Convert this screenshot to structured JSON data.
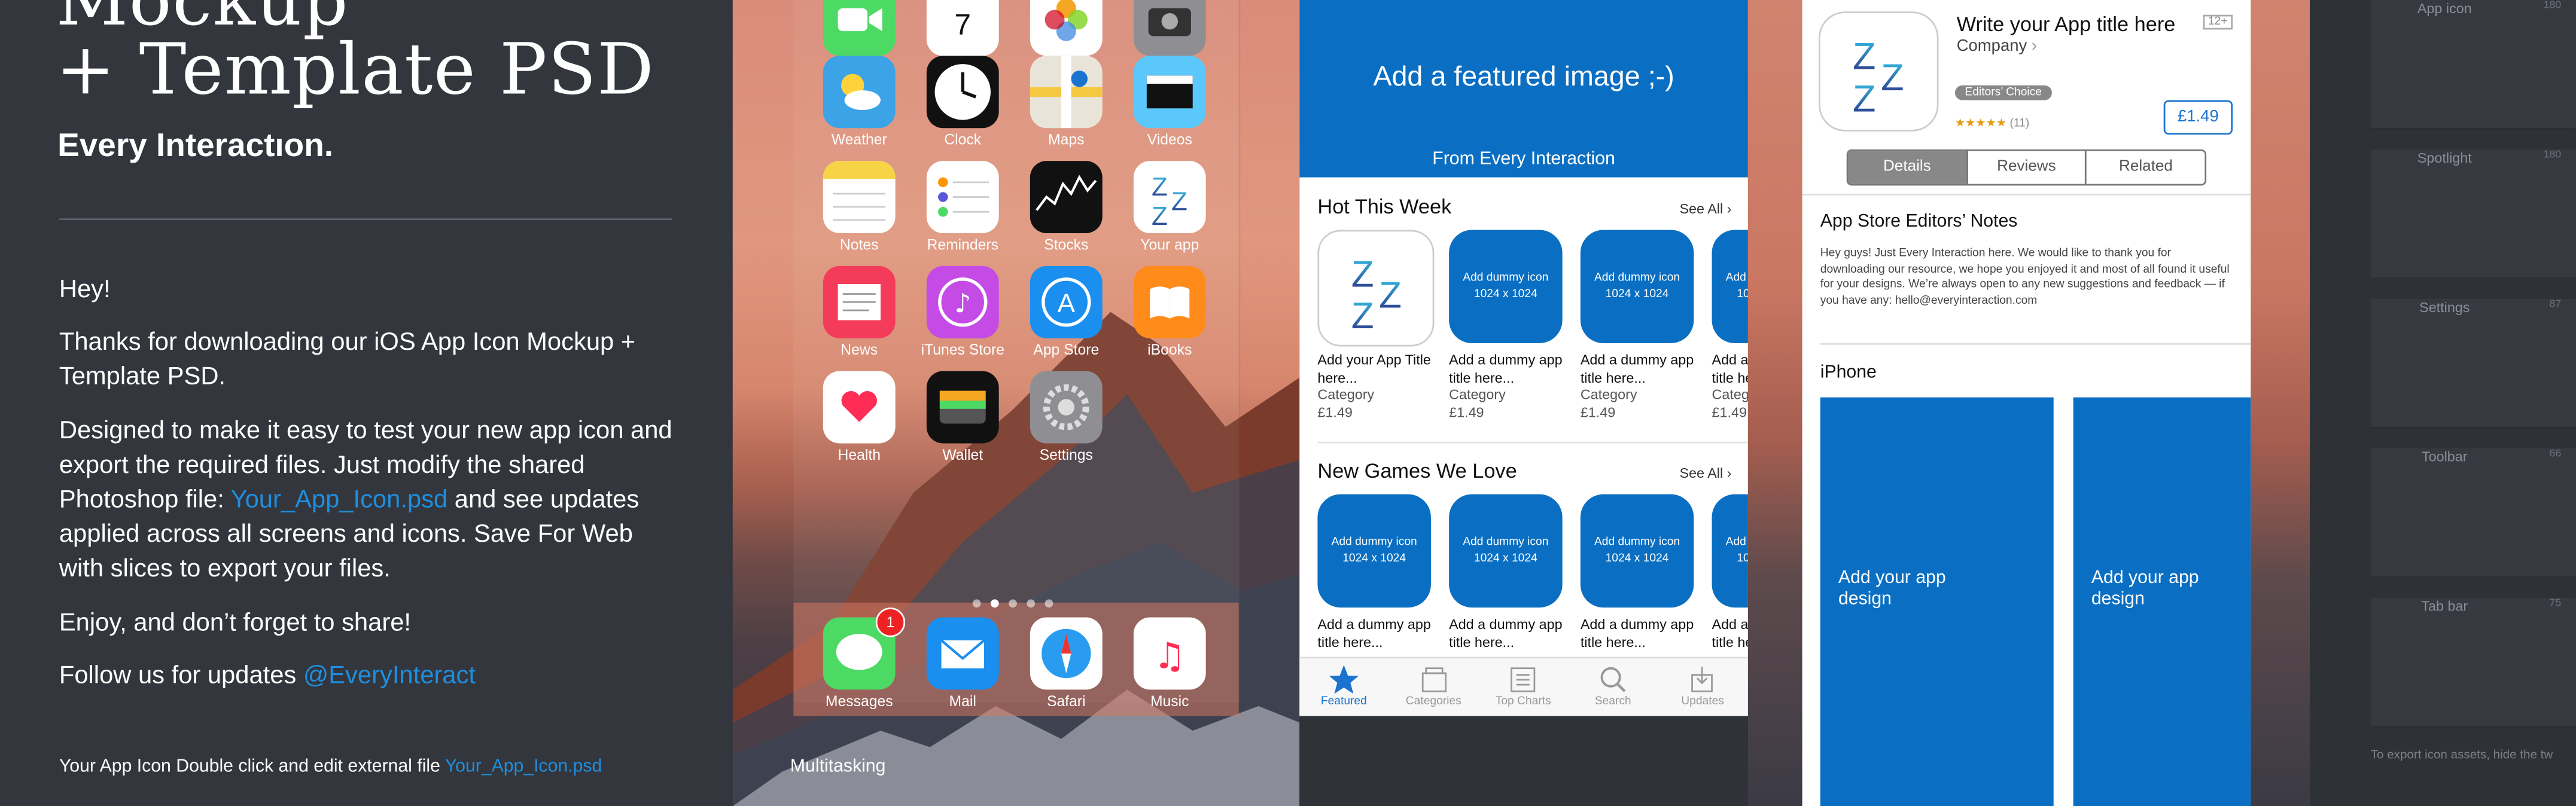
{
  "left": {
    "hero_line1": "Mockup",
    "hero_line2": "+ Template PSD",
    "brand": "Every Interactıon.",
    "p1": "Hey!",
    "p2": "Thanks for downloading our iOS App Icon Mockup + Template PSD.",
    "p3_a": "Designed to make it easy to test your new app icon and export the required files. Just modify the shared Photoshop file: ",
    "p3_link": "Your_App_Icon.psd",
    "p3_b": " and see updates applied across all screens and icons. Save For Web with slices to export your files.",
    "p4": "Enjoy, and don’t forget to share!",
    "p5_a": "Follow us for updates ",
    "p5_link": "@EveryInteract",
    "footnote_a": "Your App Icon Double click and edit external file ",
    "footnote_link": "Your_App_Icon.psd"
  },
  "home": {
    "row0": [
      "Facetime",
      "Calendar",
      "Photos",
      "Camera"
    ],
    "row1": [
      "Weather",
      "Clock",
      "Maps",
      "Videos"
    ],
    "row2": [
      "Notes",
      "Reminders",
      "Stocks",
      "Your app"
    ],
    "row3": [
      "News",
      "iTunes Store",
      "App Store",
      "iBooks"
    ],
    "row4": [
      "Health",
      "Wallet",
      "Settings"
    ],
    "dock": [
      "Messages",
      "Mail",
      "Safari",
      "Music"
    ],
    "messages_badge": "1",
    "multitasking": "Multitasking",
    "zz_letters": "ZZZ"
  },
  "store": {
    "featured_title": "Add a featured image ;-)",
    "featured_sub": "From Every Interaction",
    "section1": "Hot This Week",
    "section2": "New Games We Love",
    "see_all": "See All",
    "dummy_line1": "Add dummy icon",
    "dummy_line2": "1024 x 1024",
    "first_title": "Add your App Title here...",
    "item_title": "Add a dummy app title here...",
    "category": "Category",
    "price": "£1.49",
    "tabs": [
      "Featured",
      "Categories",
      "Top Charts",
      "Search",
      "Updates"
    ]
  },
  "detail": {
    "title": "Write your App title here",
    "age": "12+",
    "company": "Company",
    "choice": "Editors’ Choice",
    "stars": "★★★★★",
    "rating_count": "(11)",
    "price": "£1.49",
    "segments": [
      "Details",
      "Reviews",
      "Related"
    ],
    "notes_heading": "App Store Editors’ Notes",
    "notes_body": "Hey guys! Just Every Interaction here. We would like to thank you for downloading our resource, we hope you enjoyed it and most of all found it useful for your designs. We’re always open to any new suggestions and feedback — if you have any: hello@everyinteraction.com",
    "iphone_heading": "iPhone",
    "shot_text": "Add your app design"
  },
  "slices": {
    "items": [
      {
        "name": "App icon",
        "size": "180"
      },
      {
        "name": "Spotlight",
        "size": "180"
      },
      {
        "name": "Settings",
        "size": "87"
      },
      {
        "name": "Toolbar",
        "size": "66"
      },
      {
        "name": "Tab bar",
        "size": "75"
      }
    ],
    "note": "To export icon assets, hide the tw"
  },
  "colors": {
    "accent": "#1e8fe0",
    "store_blue": "#0a6fc2",
    "panel": "#33363c"
  }
}
